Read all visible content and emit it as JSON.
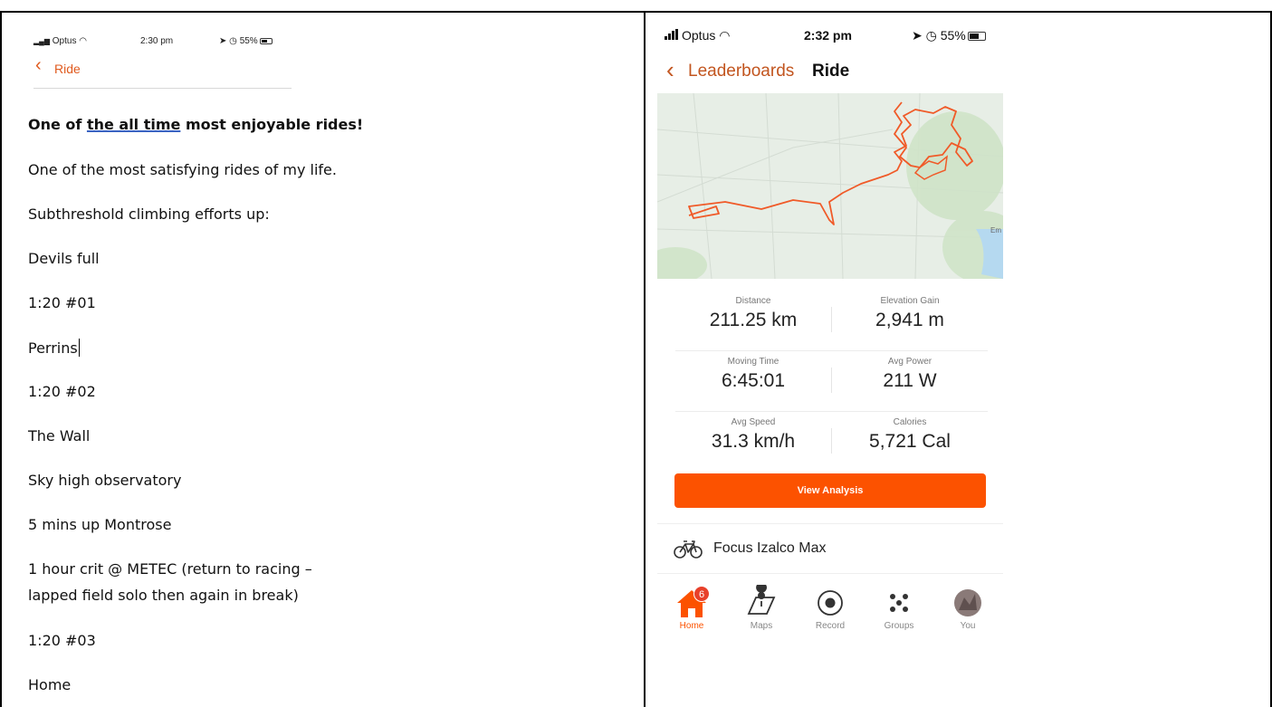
{
  "left_panel": {
    "status_bar": {
      "carrier": "Optus",
      "time": "2:30 pm",
      "battery": "55%"
    },
    "nav": {
      "back_label": "Ride"
    },
    "document": {
      "title_parts": [
        "One of ",
        "the all time",
        " most enjoyable rides!"
      ],
      "paragraphs": [
        "One of the most satisfying rides of my life.",
        "Subthreshold climbing efforts up:",
        "Devils full",
        "1:20 #01",
        "Perrins",
        "1:20 #02",
        "The Wall",
        "Sky high observatory",
        "5 mins up Montrose",
        "1 hour crit @ METEC (return to racing –",
        "lapped field solo then again in break)",
        "1:20 #03",
        "Home"
      ]
    }
  },
  "right_panel": {
    "status_bar": {
      "carrier": "Optus",
      "time": "2:32 pm",
      "battery": "55%"
    },
    "nav": {
      "back_label": "Leaderboards",
      "title": "Ride"
    },
    "map": {
      "edge_label": "Em"
    },
    "stats": [
      {
        "label": "Distance",
        "value": "211.25 km"
      },
      {
        "label": "Elevation Gain",
        "value": "2,941 m"
      },
      {
        "label": "Moving Time",
        "value": "6:45:01"
      },
      {
        "label": "Avg Power",
        "value": "211 W"
      },
      {
        "label": "Avg Speed",
        "value": "31.3 km/h"
      },
      {
        "label": "Calories",
        "value": "5,721 Cal"
      }
    ],
    "action_button": "View Analysis",
    "gear": "Focus Izalco Max",
    "tabs": [
      {
        "label": "Home",
        "icon": "home-icon",
        "badge": "6"
      },
      {
        "label": "Maps",
        "icon": "map-icon"
      },
      {
        "label": "Record",
        "icon": "record-icon"
      },
      {
        "label": "Groups",
        "icon": "groups-icon"
      },
      {
        "label": "You",
        "icon": "avatar-icon"
      }
    ],
    "colors": {
      "accent": "#fc5200",
      "route": "#f05a28",
      "back": "#c2551f"
    }
  }
}
